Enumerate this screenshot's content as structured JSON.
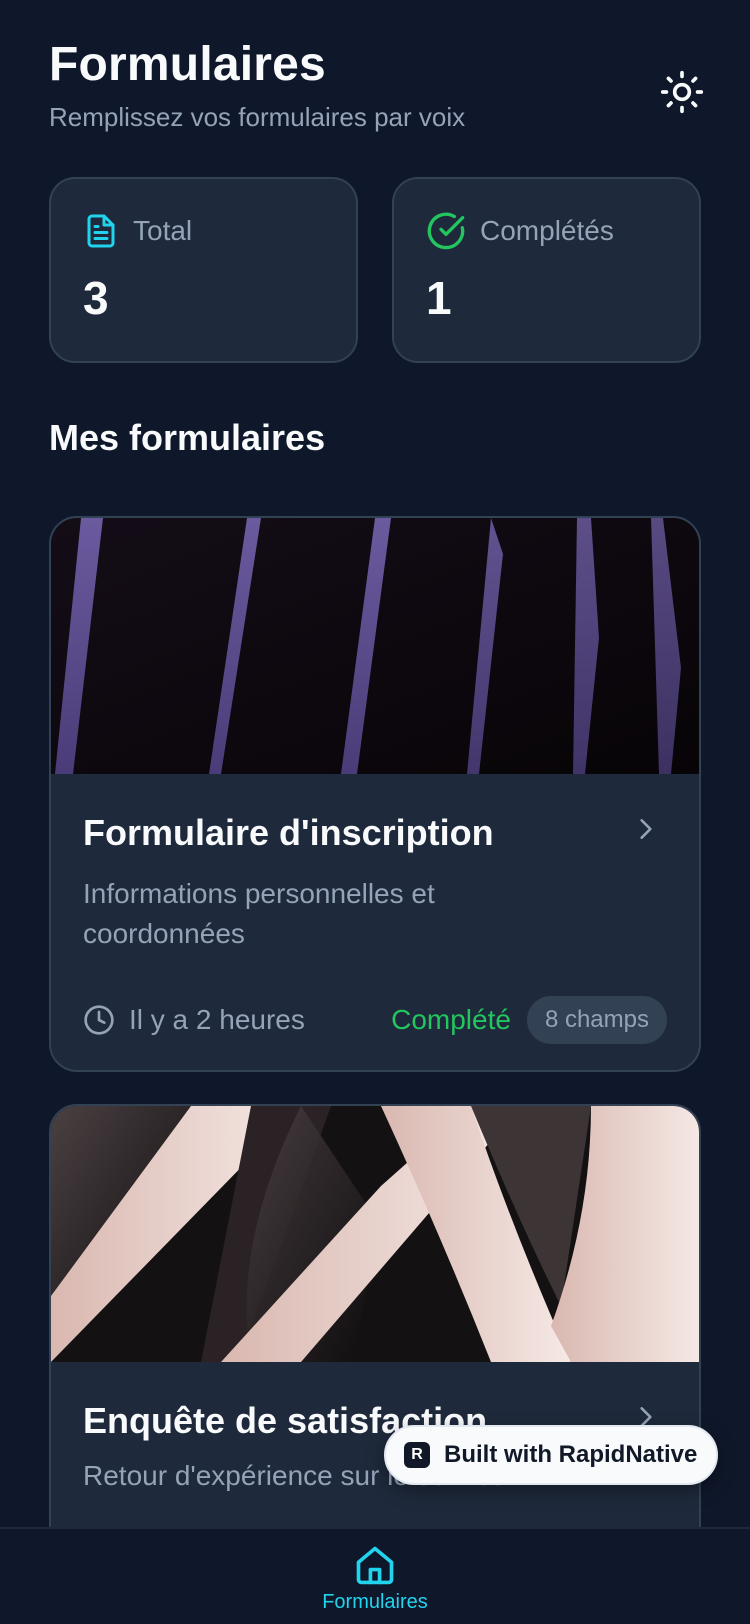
{
  "header": {
    "title": "Formulaires",
    "subtitle": "Remplissez vos formulaires par voix"
  },
  "stats": [
    {
      "label": "Total",
      "value": "3",
      "icon": "document-icon",
      "color": "#22d3ee"
    },
    {
      "label": "Complétés",
      "value": "1",
      "icon": "check-circle-icon",
      "color": "#22c55e"
    }
  ],
  "section": {
    "title": "Mes formulaires"
  },
  "forms": [
    {
      "title": "Formulaire d'inscription",
      "description": "Informations personnelles et coordonnées",
      "time": "Il y a 2 heures",
      "status": "Complété",
      "fields": "8 champs"
    },
    {
      "title": "Enquête de satisfaction",
      "description": "Retour d'expérience sur le service"
    }
  ],
  "nav": {
    "label": "Formulaires"
  },
  "badge": {
    "text": "Built with RapidNative"
  },
  "colors": {
    "background": "#0f172a",
    "card": "#1e293b",
    "accent": "#22d3ee",
    "success": "#22c55e"
  }
}
